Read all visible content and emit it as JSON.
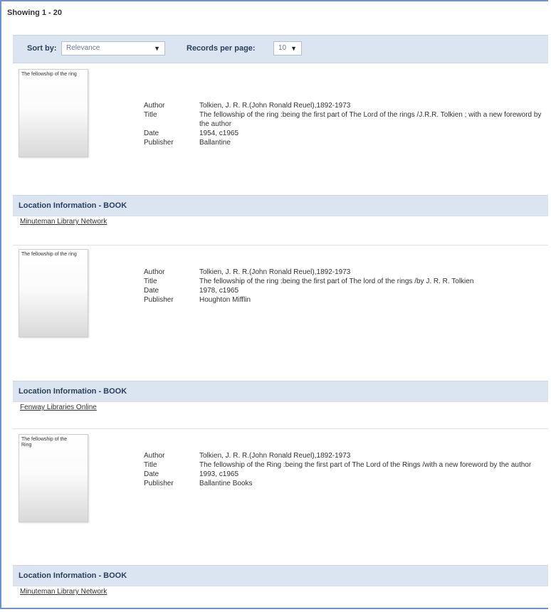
{
  "summary": {
    "showing": "Showing 1 - 20"
  },
  "sort": {
    "sort_label": "Sort by:",
    "sort_value": "Relevance",
    "rpp_label": "Records per page:",
    "rpp_value": "10"
  },
  "field_labels": {
    "author": "Author",
    "title": "Title",
    "date": "Date",
    "publisher": "Publisher"
  },
  "records": [
    {
      "thumb_text": "The fellowship of the ring",
      "author": "Tolkien, J. R. R.(John Ronald Reuel),1892-1973",
      "title": "The fellowship of the ring :being the first part of The Lord of the rings /J.R.R. Tolkien ; with a new foreword by the author",
      "date": "1954, c1965",
      "publisher": "Ballantine",
      "location_header": "Location Information - BOOK",
      "library": "Minuteman Library Network"
    },
    {
      "thumb_text": "The fellowship of the ring",
      "author": "Tolkien, J. R. R.(John Ronald Reuel),1892-1973",
      "title": "The fellowship of the ring :being the first part of The lord of the rings /by J. R. R. Tolkien",
      "date": "1978, c1965",
      "publisher": "Houghton Mifflin",
      "location_header": "Location Information - BOOK",
      "library": "Fenway Libraries Online"
    },
    {
      "thumb_text": "The fellowship of the Ring",
      "author": "Tolkien, J. R. R.(John Ronald Reuel),1892-1973",
      "title": "The fellowship of the Ring :being the first part of The Lord of the Rings /with a new foreword by the author",
      "date": "1993, c1965",
      "publisher": "Ballantine Books",
      "location_header": "Location Information - BOOK",
      "library": "Minuteman Library Network"
    }
  ]
}
